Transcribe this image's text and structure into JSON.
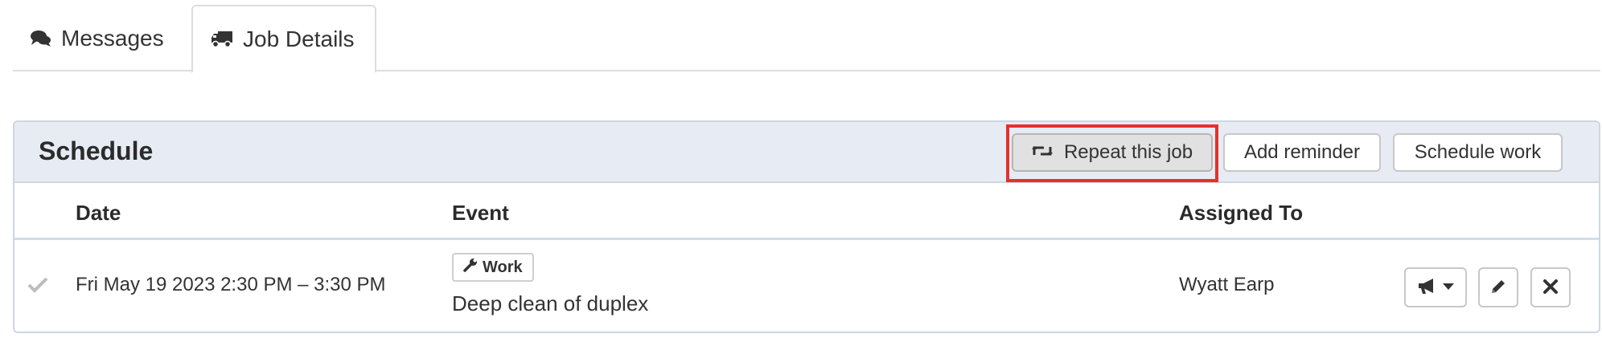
{
  "tabs": [
    {
      "label": "Messages",
      "icon": "comments-icon"
    },
    {
      "label": "Job Details",
      "icon": "truck-icon"
    }
  ],
  "schedule": {
    "title": "Schedule",
    "buttons": {
      "repeat": {
        "label": "Repeat this job",
        "icon": "retweet-icon"
      },
      "reminder": {
        "label": "Add reminder"
      },
      "schedule_work": {
        "label": "Schedule work"
      }
    },
    "columns": [
      "Date",
      "Event",
      "Assigned To"
    ],
    "rows": [
      {
        "date": "Fri May 19 2023 2:30 PM – 3:30 PM",
        "badge": "Work",
        "badge_icon": "wrench-icon",
        "event": "Deep clean of duplex",
        "assigned_to": "Wyatt Earp"
      }
    ]
  },
  "colors": {
    "highlight": "#e5312b",
    "header_bg": "#e7ebf3",
    "border": "#cfd6e3"
  }
}
